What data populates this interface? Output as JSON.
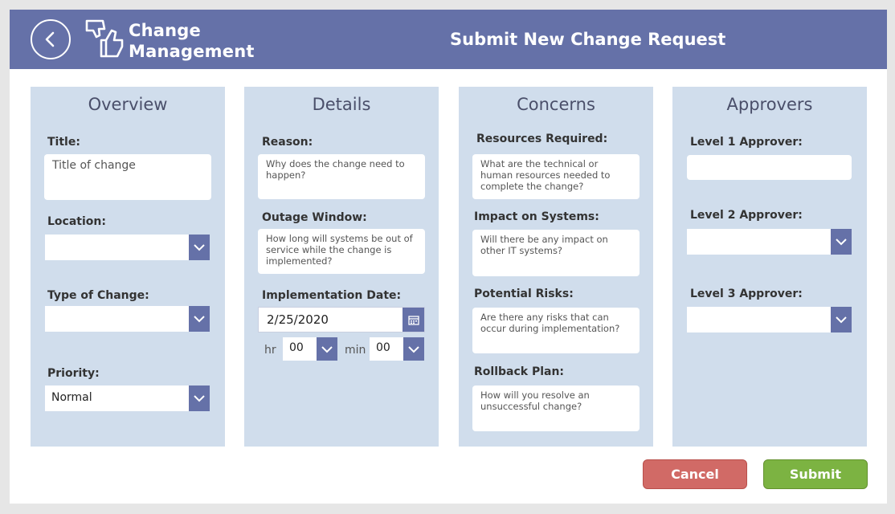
{
  "header": {
    "app_title_line1": "Change",
    "app_title_line2": "Management",
    "page_title": "Submit New Change Request"
  },
  "overview": {
    "title": "Overview",
    "title_label": "Title:",
    "title_placeholder": "Title of change",
    "location_label": "Location:",
    "location_value": "",
    "type_label": "Type of Change:",
    "type_value": "",
    "priority_label": "Priority:",
    "priority_value": "Normal"
  },
  "details": {
    "title": "Details",
    "reason_label": "Reason:",
    "reason_placeholder": "Why does the change need to happen?",
    "outage_label": "Outage Window:",
    "outage_placeholder": "How long will systems be out of service while the change is implemented?",
    "impl_label": "Implementation Date:",
    "impl_date": "2/25/2020",
    "hr_label": "hr",
    "hr_value": "00",
    "min_label": "min",
    "min_value": "00"
  },
  "concerns": {
    "title": "Concerns",
    "resources_label": "Resources Required:",
    "resources_placeholder": "What are the technical or human resources needed to complete the change?",
    "impact_label": "Impact on Systems:",
    "impact_placeholder": "Will there be any impact on other IT systems?",
    "risks_label": "Potential Risks:",
    "risks_placeholder": "Are there any risks that can occur during implementation?",
    "rollback_label": "Rollback Plan:",
    "rollback_placeholder": "How will you resolve an unsuccessful change?"
  },
  "approvers": {
    "title": "Approvers",
    "level1_label": "Level 1 Approver:",
    "level1_value": "",
    "level2_label": "Level 2 Approver:",
    "level2_value": "",
    "level3_label": "Level 3 Approver:",
    "level3_value": ""
  },
  "footer": {
    "cancel_label": "Cancel",
    "submit_label": "Submit"
  },
  "colors": {
    "header": "#6571a8",
    "panel": "#d0ddec",
    "cancel": "#d16a66",
    "submit": "#7cb342"
  },
  "icons": {
    "back": "back-arrow-icon",
    "logo": "thumbs-up-down-icon",
    "dropdown": "chevron-down-icon",
    "calendar": "calendar-icon"
  }
}
